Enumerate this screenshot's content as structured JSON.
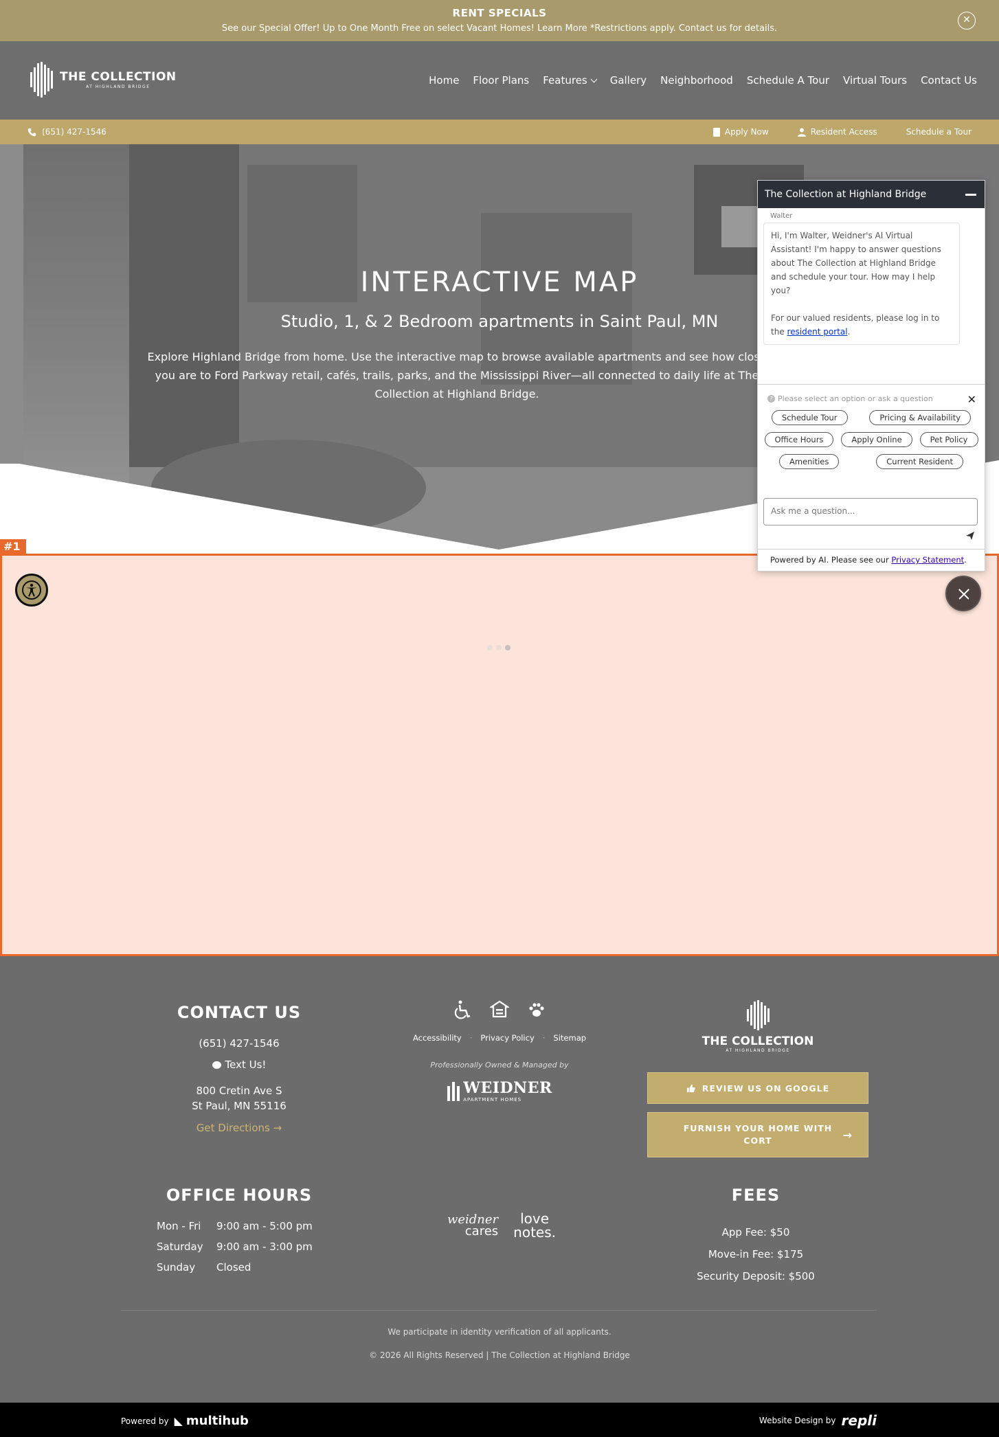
{
  "banner": {
    "title": "RENT SPECIALS",
    "text": "See our Special Offer! Up to One Month Free on select Vacant Homes! Learn More *Restrictions apply. Contact us for details.",
    "close_icon": "close-icon"
  },
  "header": {
    "logo_title": "THE COLLECTION",
    "logo_sub": "AT HIGHLAND BRIDGE",
    "nav": [
      "Home",
      "Floor Plans",
      "Features",
      "Gallery",
      "Neighborhood",
      "Schedule A Tour",
      "Virtual Tours",
      "Contact Us"
    ]
  },
  "utility": {
    "phone": "(651) 427-1546",
    "apply": "Apply Now",
    "resident": "Resident Access",
    "tour": "Schedule a Tour"
  },
  "hero": {
    "title": "INTERACTIVE MAP",
    "subtitle": "Studio, 1, & 2 Bedroom apartments in Saint Paul, MN",
    "description": "Explore Highland Bridge from home. Use the interactive map to browse available apartments and see how close you are to Ford Parkway retail, cafés, trails, parks, and the Mississippi River—all connected to daily life at The Collection at Highland Bridge."
  },
  "chat": {
    "title": "The Collection at Highland Bridge",
    "sender": "Walter",
    "message": "Hi, I'm Walter, Weidner's AI Virtual Assistant! I'm happy to answer questions about The Collection at Highland Bridge and schedule your tour. How may I help you?",
    "message2": "For our valued residents, please log in to the",
    "portal_link": "resident portal",
    "prompt": "Please select an option or ask a question",
    "options": [
      "Schedule Tour",
      "Pricing & Availability",
      "Office Hours",
      "Apply Online",
      "Pet Policy",
      "Amenities",
      "Current Resident"
    ],
    "input_placeholder": "Ask me a question...",
    "footer_text": "Powered by AI. Please see our",
    "privacy_link": "Privacy Statement"
  },
  "map": {
    "tag": "#1"
  },
  "footer": {
    "contact": {
      "heading": "CONTACT US",
      "phone": "(651) 427-1546",
      "text_us": "Text Us!",
      "address1": "800 Cretin Ave S",
      "address2": "St Paul, MN 55116",
      "directions": "Get Directions"
    },
    "links": [
      "Accessibility",
      "Privacy Policy",
      "Sitemap"
    ],
    "managed": "Professionally Owned & Managed by",
    "weidner": "WEIDNER",
    "weidner_sub": "APARTMENT HOMES",
    "logo_title": "THE COLLECTION",
    "logo_sub": "AT HIGHLAND BRIDGE",
    "review_button": "REVIEW US ON GOOGLE",
    "cort_button": "FURNISH YOUR HOME WITH CORT",
    "hours": {
      "heading": "OFFICE HOURS",
      "rows": [
        {
          "day": "Mon - Fri",
          "time": "9:00 am - 5:00 pm"
        },
        {
          "day": "Saturday",
          "time": "9:00 am - 3:00 pm"
        },
        {
          "day": "Sunday",
          "time": "Closed"
        }
      ]
    },
    "cares_1": "weidner",
    "cares_2": "cares",
    "love_1": "love",
    "love_2": "notes.",
    "fees": {
      "heading": "FEES",
      "items": [
        "App Fee: $50",
        "Move-in Fee: $175",
        "Security Deposit: $500"
      ]
    },
    "note": "We participate in identity verification of all applicants.",
    "copyright": "© 2026 All Rights Reserved | The Collection at Highland Bridge"
  },
  "bottom": {
    "powered_by": "Powered by",
    "multihub": "multihub",
    "design_by": "Website Design by",
    "repli": "repli"
  }
}
